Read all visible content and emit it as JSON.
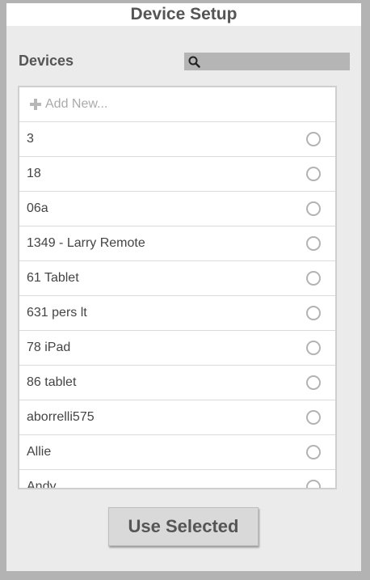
{
  "header": {
    "title": "Device Setup"
  },
  "devices_section": {
    "label": "Devices",
    "search": {
      "value": "",
      "placeholder": ""
    },
    "add_new_label": "Add New...",
    "items": [
      {
        "label": "3",
        "selected": false
      },
      {
        "label": "18",
        "selected": false
      },
      {
        "label": "06a",
        "selected": false
      },
      {
        "label": "1349 - Larry Remote",
        "selected": false
      },
      {
        "label": "61 Tablet",
        "selected": false
      },
      {
        "label": "631 pers lt",
        "selected": false
      },
      {
        "label": "78 iPad",
        "selected": false
      },
      {
        "label": "86 tablet",
        "selected": false
      },
      {
        "label": "aborrelli575",
        "selected": false
      },
      {
        "label": "Allie",
        "selected": false
      },
      {
        "label": "Andy",
        "selected": false
      }
    ]
  },
  "footer": {
    "use_selected_label": "Use Selected"
  },
  "colors": {
    "background": "#b3b3b3",
    "panel": "#ebebeb",
    "text": "#555555",
    "search_bg": "#b5b5b5",
    "radio_border": "#b3b3b3"
  }
}
